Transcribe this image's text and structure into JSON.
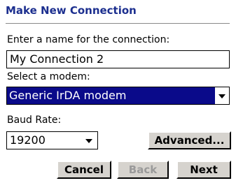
{
  "title": "Make New Connection",
  "name_prompt": "Enter a name for the connection:",
  "connection_name": "My Connection 2",
  "modem_prompt": "Select a modem:",
  "modem_selected": "Generic IrDA modem",
  "baud_prompt": "Baud Rate:",
  "baud_selected": "19200",
  "buttons": {
    "advanced": "Advanced...",
    "cancel": "Cancel",
    "back": "Back",
    "next": "Next"
  },
  "colors": {
    "title": "#1c2f8f",
    "selection": "#0a0a8a",
    "button_face": "#d6d3ce",
    "disabled_text": "#9a9a9a"
  },
  "icons": [
    "dropdown-arrow-icon"
  ]
}
